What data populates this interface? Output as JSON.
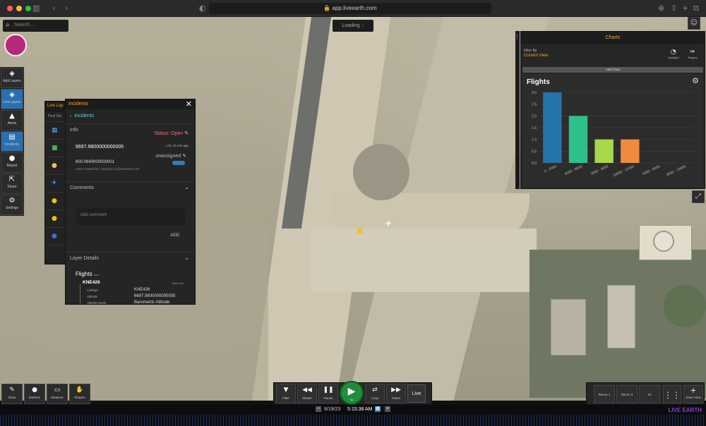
{
  "browser": {
    "url": "app.liveearth.com"
  },
  "search": {
    "placeholder": "Search..."
  },
  "loading": {
    "label": "Loading"
  },
  "left_toolbar": [
    {
      "label": "Add Layers",
      "icon": "layers-add-icon",
      "glyph": "◈"
    },
    {
      "label": "Live Layers",
      "icon": "layers-icon",
      "glyph": "◈",
      "active": true
    },
    {
      "label": "Alerts",
      "icon": "alert-icon",
      "glyph": "▲"
    },
    {
      "label": "Incidents",
      "icon": "clipboard-icon",
      "glyph": "▤",
      "active": true
    },
    {
      "label": "Report",
      "icon": "pin-icon",
      "glyph": "●"
    },
    {
      "label": "Share",
      "icon": "share-icon",
      "glyph": "⇱"
    },
    {
      "label": "Settings",
      "icon": "gear-icon",
      "glyph": "⚙"
    }
  ],
  "live_layers": {
    "title": "Live Lay",
    "find": "Find Ma"
  },
  "incidents": {
    "title": "Incidents",
    "back": "Incidents",
    "info_label": "Info",
    "status": "Status: Open",
    "incident_id": "6697.9800000000005",
    "time_ago": "1 hr, 44 min ago",
    "assignee": "unassigned",
    "value2": "800.0640000000001",
    "created_by": "Alert Created By: hamjsky.roc@liveearth.com",
    "comments_label": "Comments",
    "comment_placeholder": "Add comment",
    "add_label": "ADD",
    "layer_details_label": "Layer Details",
    "layer_name": "Flights",
    "layer_sub": "layer",
    "callsign_header": "KNE426",
    "attributes_label": "attributes",
    "rows": [
      {
        "k": "Callsign",
        "v": "KNE426"
      },
      {
        "k": "Altitude",
        "v": "6697.9800000000005"
      },
      {
        "k": "Altitude Mode",
        "v": "Barometric Altitude"
      }
    ]
  },
  "charts_panel": {
    "title": "Charts",
    "filter_label": "Filter By",
    "filter_value": "Current View",
    "spotlight": "Spotlight",
    "shapes": "Shapes",
    "add_chart": "Add Chart",
    "chart_title": "Flights"
  },
  "chart_data": {
    "type": "bar",
    "title": "Flights",
    "categories": [
      "0 - 2000",
      "6000 - 8000",
      "2000 - 4000",
      "10000 - 12000",
      "4000 - 6000",
      "8000 - 10000"
    ],
    "values": [
      3.0,
      2.0,
      1.0,
      1.0
    ],
    "yticks": [
      "0.0",
      "0.5",
      "1.0",
      "1.5",
      "2.0",
      "2.5",
      "3.0"
    ],
    "ylim": [
      0,
      3.0
    ],
    "colors": [
      "#2574a9",
      "#2ec08a",
      "#a6d84a",
      "#f08a3e"
    ],
    "grid": true
  },
  "bottom_tools": [
    {
      "label": "Draw",
      "glyph": "✎"
    },
    {
      "label": "Markers",
      "glyph": "●"
    },
    {
      "label": "Measure",
      "glyph": "▭"
    },
    {
      "label": "Shapes",
      "glyph": "✋"
    }
  ],
  "playback": {
    "buttons": [
      {
        "label": "Filter",
        "glyph": "▼"
      },
      {
        "label": "Slower",
        "glyph": "◀◀"
      },
      {
        "label": "Pause",
        "glyph": "❚❚"
      }
    ],
    "play_label": "1x",
    "buttons2": [
      {
        "label": "Loop",
        "glyph": "⇄"
      },
      {
        "label": "Faster",
        "glyph": "▶▶"
      }
    ],
    "live": "Live"
  },
  "right_tools": {
    "recon1": "Recon 1",
    "recon2": "Recon 2",
    "btn3": "10",
    "save_view": "Save View"
  },
  "timeline": {
    "date": "9/19/23",
    "time": "5:15:38 AM",
    "brand": "LIVE EARTH"
  }
}
